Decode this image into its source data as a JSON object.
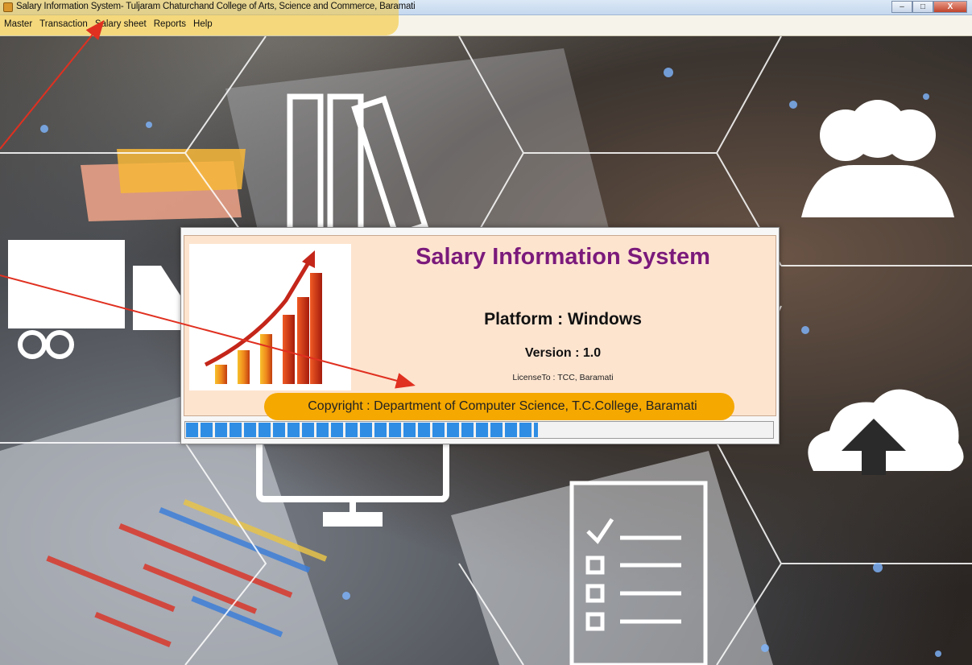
{
  "window": {
    "title": "Salary Information System- Tuljaram Chaturchand College of Arts, Science and Commerce, Baramati",
    "icon": "app-icon",
    "controls": {
      "minimize": "–",
      "maximize": "□",
      "close": "X"
    }
  },
  "menu": {
    "items": [
      "Master",
      "Transaction",
      "Salary sheet",
      "Reports",
      "Help"
    ]
  },
  "splash": {
    "title": "Salary Information System",
    "platform": "Platform : Windows",
    "version": "Version : 1.0",
    "license": "LicenseTo : TCC, Baramati",
    "copyright": "Copyright : Department of Computer Science, T.C.College, Baramati",
    "progress_fraction": 0.6,
    "image": "rising-bar-chart-with-arrow"
  },
  "colors": {
    "title_purple": "#7b1a7b",
    "splash_bg": "#fde4cf",
    "progress_blue": "#2f8de4",
    "highlight_orange": "#f5a800",
    "annotation_red": "#e03020"
  }
}
